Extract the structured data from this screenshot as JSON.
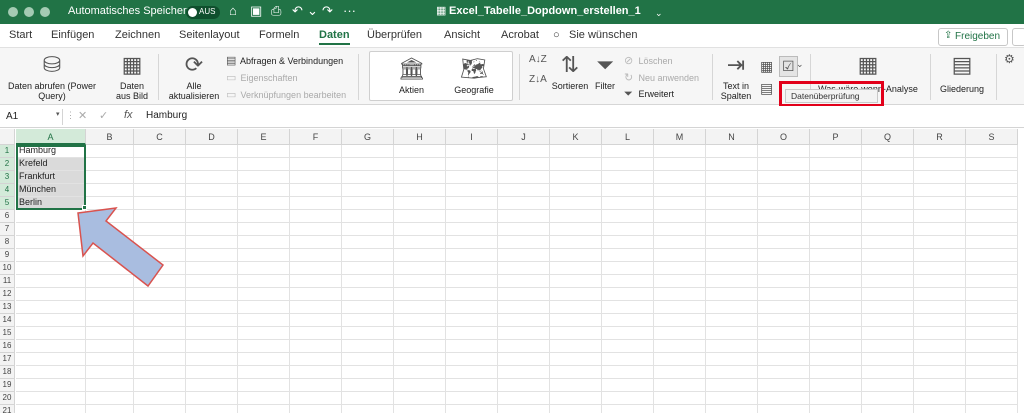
{
  "titlebar": {
    "autosave_label": "Automatisches Speichern",
    "autosave_state": "AUS",
    "doc_title": "Excel_Tabelle_Dopdown_erstellen_1"
  },
  "menu": {
    "tabs": [
      "Start",
      "Einfügen",
      "Zeichnen",
      "Seitenlayout",
      "Formeln",
      "Daten",
      "Überprüfen",
      "Ansicht",
      "Acrobat"
    ],
    "active_tab": "Daten",
    "search_label": "Sie wünschen",
    "share_label": "Freigeben"
  },
  "ribbon": {
    "get_data": "Daten abrufen (Power Query)",
    "from_picture": "Daten aus Bild",
    "refresh_all": "Alle aktualisieren",
    "queries": "Abfragen & Verbindungen",
    "properties": "Eigenschaften",
    "edit_links": "Verknüpfungen bearbeiten",
    "stocks": "Aktien",
    "geography": "Geografie",
    "sort": "Sortieren",
    "filter": "Filter",
    "clear": "Löschen",
    "reapply": "Neu anwenden",
    "advanced": "Erweitert",
    "text_to_columns": "Text in Spalten",
    "what_if": "Was-wäre-wenn-Analyse",
    "outline": "Gliederung",
    "tooltip": "Datenüberprüfung"
  },
  "formula_bar": {
    "name_box": "A1",
    "fx": "fx",
    "value": "Hamburg"
  },
  "sheet": {
    "columns": [
      "A",
      "B",
      "C",
      "D",
      "E",
      "F",
      "G",
      "H",
      "I",
      "J",
      "K",
      "L",
      "M",
      "N",
      "O",
      "P",
      "Q",
      "R",
      "S"
    ],
    "rows": [
      "1",
      "2",
      "3",
      "4",
      "5",
      "6",
      "7",
      "8",
      "9",
      "10",
      "11",
      "12",
      "13",
      "14",
      "15",
      "16",
      "17",
      "18",
      "19",
      "20",
      "21"
    ],
    "column_a_values": [
      "Hamburg",
      "Krefeld",
      "Frankfurt",
      "München",
      "Berlin"
    ]
  },
  "colors": {
    "brand": "#217346",
    "highlight": "#e2001a",
    "arrow_fill": "#a9bde0",
    "arrow_stroke": "#d9534f"
  }
}
